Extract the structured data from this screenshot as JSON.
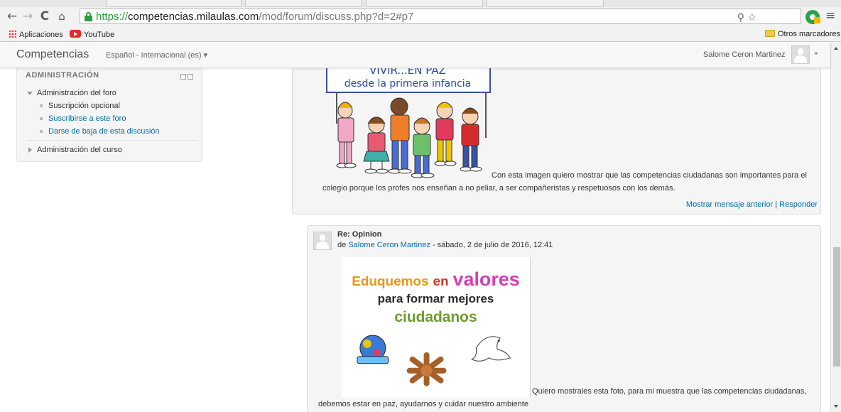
{
  "browser": {
    "url_scheme": "https://",
    "url_host": "competencias.milaulas.com",
    "url_path": "/mod/forum/discuss.php?d=2#p7",
    "bookmarks": [
      {
        "label": "Aplicaciones",
        "icon": "apps-grid-icon"
      },
      {
        "label": "YouTube",
        "icon": "youtube-icon"
      }
    ],
    "other_bookmarks": "Otros marcadores",
    "nav_icons": [
      "back-arrow-icon",
      "forward-arrow-icon",
      "reload-icon",
      "home-icon",
      "lock-icon",
      "zoom-icon",
      "star-icon",
      "extension-icon",
      "menu-icon"
    ]
  },
  "navbar": {
    "brand": "Competencias",
    "language": "Español - Internacional (es) ▾",
    "user_name": "Salome Ceron Martinez"
  },
  "admin_block": {
    "title": "ADMINISTRACIÓN",
    "forum_admin": "Administración del foro",
    "items": [
      {
        "label": "Suscripción opcional",
        "link": false
      },
      {
        "label": "Suscribirse a este foro",
        "link": true
      },
      {
        "label": "Darse de baja de esta discusión",
        "link": true
      }
    ],
    "course_admin": "Administración del curso"
  },
  "post1": {
    "image_banner": "VIVIR...EN PAZ desde la primera infancia",
    "text_line1": "Con esta imagen quiero mostrar que las competencias ciudadanas son importantes para el",
    "text_line2": "colegio porque los profes nos enseñan a no peliar, a ser compañeristas y respetuosos con los demás.",
    "show_parent": "Mostrar mensaje anterior",
    "separator": "|",
    "reply": "Responder"
  },
  "post2": {
    "subject": "Re: Opinion",
    "by": "de",
    "author": "Salome Ceron Martinez",
    "date": "- sábado, 2 de julio de 2016, 12:41",
    "image_text": {
      "word1": "Eduquemos",
      "word2": "en",
      "word3": "valores",
      "line2": "para formar mejores",
      "line3": "ciudadanos"
    },
    "text_line1": "Quiero mostrales esta foto, para mi muestra que las competencias ciudadanas,",
    "text_line2": "debemos estar en paz, ayudarnos y cuidar nuestro ambiente"
  },
  "colors": {
    "link": "#0070a8",
    "secure_green": "#2e9d3b",
    "eduquemos_orange": "#e8961a",
    "valores_magenta": "#d63fb4",
    "ciudadanos_green": "#6f9a2f"
  }
}
